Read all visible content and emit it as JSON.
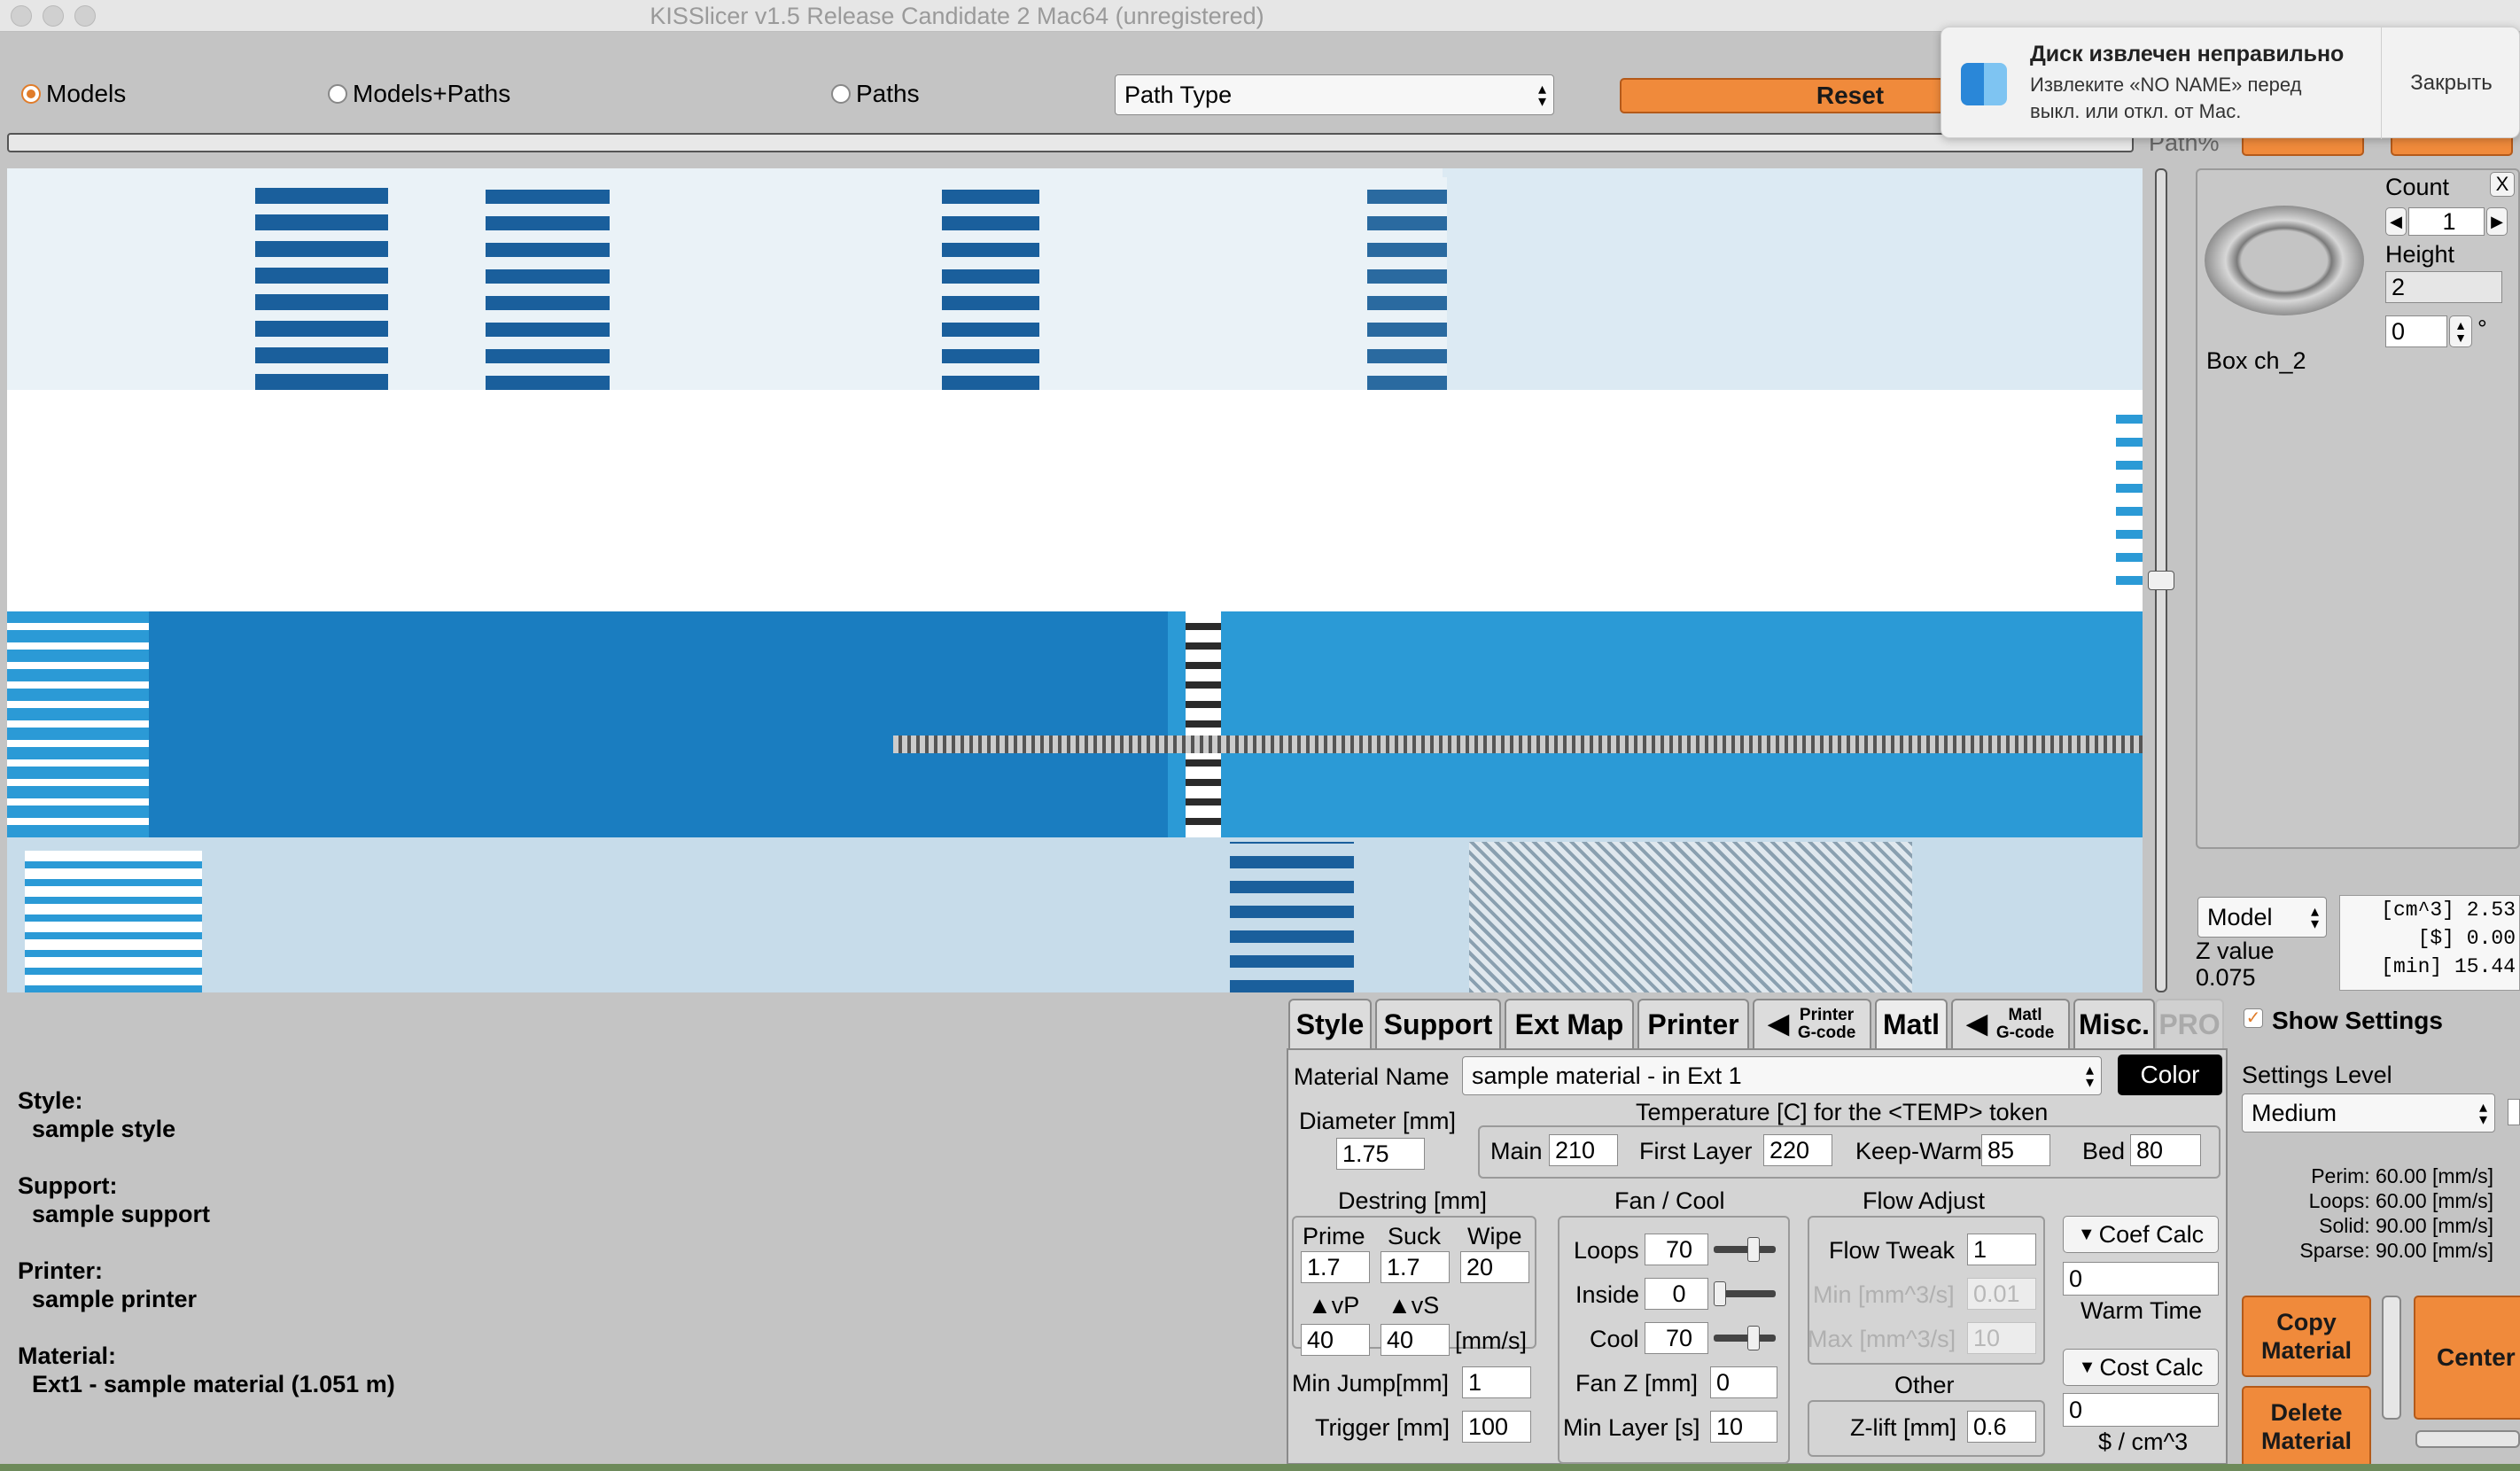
{
  "window": {
    "title": "KISSlicer v1.5 Release Candidate 2 Mac64 (unregistered)"
  },
  "toolbar": {
    "view_models": "Models",
    "view_models_paths": "Models+Paths",
    "view_paths": "Paths",
    "path_type": "Path Type",
    "reset": "Reset",
    "path_pct": "Path%"
  },
  "notification": {
    "title": "Диск извлечен неправильно",
    "body": "Извлеките «NO NAME» перед выкл. или откл. от Mac.",
    "close": "Закрыть"
  },
  "object_panel": {
    "count_label": "Count",
    "count_value": "1",
    "height_label": "Height",
    "height_value": "2",
    "rotation_value": "0",
    "degree": "°",
    "close": "X",
    "name": "Box ch_2",
    "mode": "Model",
    "z_label": "Z value",
    "z_value": "0.075",
    "stats": [
      "[cm^3] 2.53",
      "[$] 0.00",
      "[min] 15.44"
    ]
  },
  "summary": {
    "style_label": "Style:",
    "style_value": "sample style",
    "support_label": "Support:",
    "support_value": "sample support",
    "printer_label": "Printer:",
    "printer_value": "sample printer",
    "material_label": "Material:",
    "material_value": "Ext1 - sample material (1.051 m)"
  },
  "tabs": {
    "style": "Style",
    "support": "Support",
    "ext_map": "Ext Map",
    "printer": "Printer",
    "printer_gcode_1": "Printer",
    "printer_gcode_2": "G-code",
    "matl": "Matl",
    "matl_gcode_1": "Matl",
    "matl_gcode_2": "G-code",
    "misc": "Misc.",
    "pro": "PRO"
  },
  "settings": {
    "show_settings": "Show Settings",
    "level_label": "Settings Level",
    "level_value": "Medium",
    "speeds": [
      "Perim: 60.00 [mm/s]",
      "Loops: 60.00 [mm/s]",
      "Solid: 90.00 [mm/s]",
      "Sparse: 90.00 [mm/s]"
    ]
  },
  "material": {
    "name_label": "Material Name",
    "name_value": "sample material - in Ext 1",
    "color_btn": "Color",
    "diameter_label": "Diameter [mm]",
    "diameter_value": "1.75",
    "temp_label": "Temperature [C] for the <TEMP> token",
    "main_label": "Main",
    "main_value": "210",
    "first_layer_label": "First Layer",
    "first_layer_value": "220",
    "keep_warm_label": "Keep-Warm",
    "keep_warm_value": "85",
    "bed_label": "Bed",
    "bed_value": "80",
    "destring_label": "Destring [mm]",
    "prime_label": "Prime",
    "prime_value": "1.7",
    "suck_label": "Suck",
    "suck_value": "1.7",
    "wipe_label": "Wipe",
    "wipe_value": "20",
    "vp_label": "vP",
    "vp_value": "40",
    "vs_label": "vS",
    "vs_value": "40",
    "mms_label": "[mm/s]",
    "min_jump_label": "Min Jump[mm]",
    "min_jump_value": "1",
    "trigger_label": "Trigger [mm]",
    "trigger_value": "100",
    "fan_label": "Fan / Cool",
    "loops_label": "Loops",
    "loops_value": "70",
    "inside_label": "Inside",
    "inside_value": "0",
    "cool_label": "Cool",
    "cool_value": "70",
    "fan_z_label": "Fan Z [mm]",
    "fan_z_value": "0",
    "min_layer_label": "Min Layer [s]",
    "min_layer_value": "10",
    "flow_label": "Flow Adjust",
    "flow_tweak_label": "Flow Tweak",
    "flow_tweak_value": "1",
    "min_flow_label": "Min [mm^3/s]",
    "min_flow_value": "0.01",
    "max_flow_label": "Max [mm^3/s]",
    "max_flow_value": "10",
    "other_label": "Other",
    "zlift_label": "Z-lift [mm]",
    "zlift_value": "0.6",
    "coef_calc": "Coef Calc",
    "coef_value": "0",
    "warm_time": "Warm Time",
    "cost_calc": "Cost Calc",
    "cost_value": "0",
    "cost_unit": "$ / cm^3",
    "copy_material_1": "Copy",
    "copy_material_2": "Material",
    "delete_material_1": "Delete",
    "delete_material_2": "Material",
    "center": "Center"
  },
  "colors": {
    "accent": "#f08a3b",
    "viewport_blue": "#2b9ad6",
    "dark_blue": "#1a7dc0"
  }
}
